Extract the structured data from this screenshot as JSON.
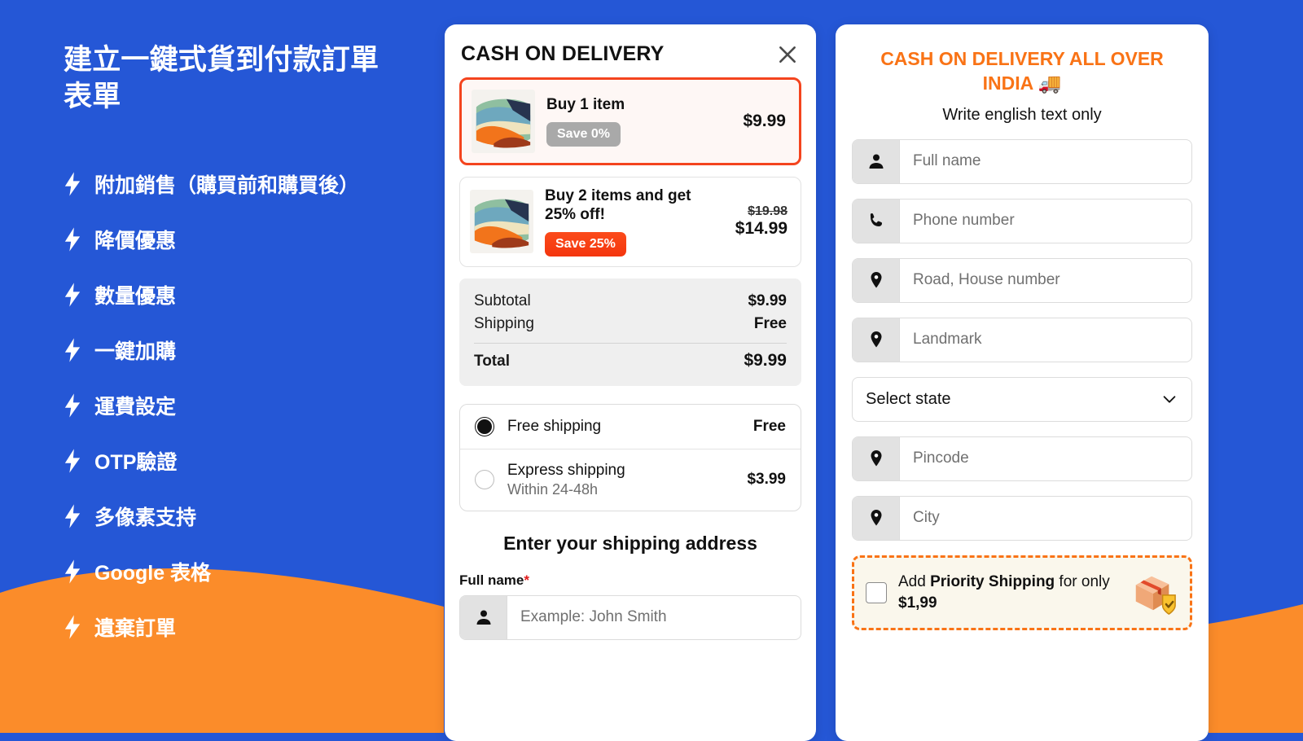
{
  "theme": {
    "blue": "#2557D6",
    "orange": "#FB8C2A",
    "accent_orange": "#F97316",
    "red": "#F4441E"
  },
  "left_panel": {
    "title": "建立一鍵式貨到付款訂單表單",
    "features": [
      {
        "icon": "bolt-icon",
        "label": "附加銷售（購買前和購買後）"
      },
      {
        "icon": "bolt-icon",
        "label": "降價優惠"
      },
      {
        "icon": "bolt-icon",
        "label": "數量優惠"
      },
      {
        "icon": "bolt-icon",
        "label": "一鍵加購"
      },
      {
        "icon": "bolt-icon",
        "label": "運費設定"
      },
      {
        "icon": "bolt-icon",
        "label": "OTP驗證"
      },
      {
        "icon": "bolt-icon",
        "label": "多像素支持"
      },
      {
        "icon": "bolt-icon",
        "label": "Google 表格"
      },
      {
        "icon": "bolt-icon",
        "label": "遺棄訂單"
      }
    ]
  },
  "checkout_card": {
    "title": "CASH ON DELIVERY",
    "close_icon": "close-icon",
    "offers": [
      {
        "name": "Buy 1 item",
        "badge": "Save 0%",
        "badge_style": "gray",
        "price_old": "",
        "price_now": "$9.99",
        "selected": true
      },
      {
        "name": "Buy 2 items and get 25% off!",
        "badge": "Save 25%",
        "badge_style": "red",
        "price_old": "$19.98",
        "price_now": "$14.99",
        "selected": false
      }
    ],
    "totals": {
      "subtotal_label": "Subtotal",
      "subtotal_value": "$9.99",
      "shipping_label": "Shipping",
      "shipping_value": "Free",
      "total_label": "Total",
      "total_value": "$9.99"
    },
    "shipping_options": [
      {
        "name": "Free shipping",
        "sub": "",
        "price": "Free",
        "selected": true
      },
      {
        "name": "Express shipping",
        "sub": "Within 24-48h",
        "price": "$3.99",
        "selected": false
      }
    ],
    "address_heading": "Enter your shipping address",
    "full_name_label": "Full name",
    "required_mark": "*",
    "full_name_placeholder": "Example: John Smith",
    "full_name_icon": "person-icon"
  },
  "address_card": {
    "title": "CASH ON DELIVERY ALL OVER INDIA 🚚",
    "subtitle": "Write english text only",
    "fields": [
      {
        "icon": "person-icon",
        "placeholder": "Full name"
      },
      {
        "icon": "phone-icon",
        "placeholder": "Phone number"
      },
      {
        "icon": "location-pin-icon",
        "placeholder": "Road, House number"
      },
      {
        "icon": "location-pin-icon",
        "placeholder": "Landmark"
      }
    ],
    "state_select": {
      "value": "Select state",
      "icon": "chevron-down-icon"
    },
    "fields_after": [
      {
        "icon": "location-pin-icon",
        "placeholder": "Pincode"
      },
      {
        "icon": "location-pin-icon",
        "placeholder": "City"
      }
    ],
    "priority": {
      "text_1": "Add ",
      "text_bold_1": "Priority Shipping",
      "text_2": " for only ",
      "text_bold_2": "$1,99",
      "icon": "package-shield-icon"
    }
  }
}
